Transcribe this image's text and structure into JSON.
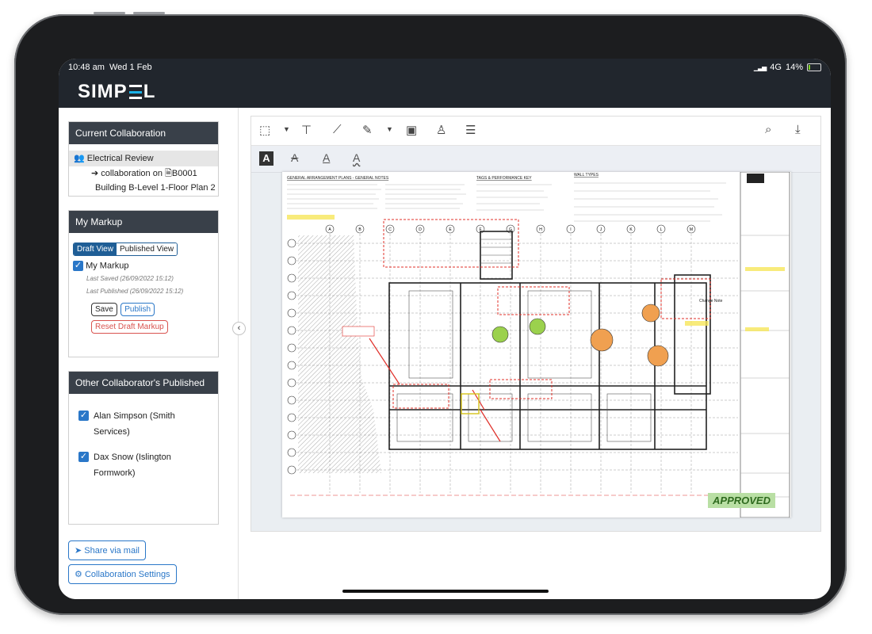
{
  "status": {
    "time": "10:48 am",
    "date": "Wed 1 Feb",
    "network": "4G",
    "battery": "14%",
    "battery_level_pct": 14
  },
  "app": {
    "logo": "SIMPEL"
  },
  "current_collab": {
    "heading": "Current Collaboration",
    "name": "Electrical Review",
    "collab_on": "collaboration on",
    "doc_code": "B0001",
    "doc_name": "Building B-Level 1-Floor Plan 2"
  },
  "my_markup": {
    "heading": "My Markup",
    "tabs": [
      "Draft View",
      "Published View"
    ],
    "active_tab": "Draft View",
    "item_label": "My Markup",
    "last_saved": "Last Saved (26/09/2022 15:12)",
    "last_published": "Last Published (26/09/2022 15:12)",
    "save": "Save",
    "publish": "Publish",
    "reset": "Reset Draft Markup"
  },
  "others": {
    "heading": "Other Collaborator's Published",
    "collaborators": [
      {
        "name": "Alan Simpson (Smith Services)",
        "checked": true
      },
      {
        "name": "Dax Snow (Islington Formwork)",
        "checked": true
      }
    ]
  },
  "actions": {
    "share": "Share via mail",
    "settings": "Collaboration Settings"
  },
  "toolbar": {
    "tools": [
      "select-region-icon",
      "text-box-icon",
      "line-icon",
      "highlighter-icon",
      "image-icon",
      "stamp-icon",
      "note-icon"
    ],
    "right_tools": [
      "search-icon",
      "download-icon"
    ],
    "text_tools": [
      "text-bold-icon",
      "text-strike-icon",
      "text-underline-icon",
      "text-squiggly-icon"
    ]
  },
  "drawing": {
    "section_headers": [
      "GENERAL ARRANGEMENT PLANS - GENERAL NOTES",
      "TAGS & PERFORMANCE KEY",
      "WALL TYPES"
    ],
    "grid_letters": [
      "A",
      "B",
      "C",
      "D",
      "E",
      "F",
      "G",
      "H",
      "I",
      "J",
      "K",
      "L",
      "M"
    ],
    "stamp": "APPROVED",
    "annotation": "Change Note",
    "accent_colors": {
      "markup_red": "#e0302a",
      "highlight_yellow": "#f6e65a",
      "orange_circle": "#f0a050",
      "green_circle": "#9bd14d"
    }
  }
}
